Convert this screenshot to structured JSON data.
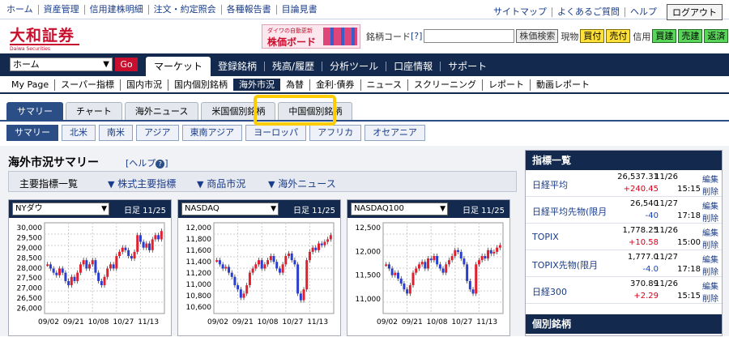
{
  "top_links": [
    "ホーム",
    "資産管理",
    "信用建株明細",
    "注文・約定照会",
    "各種報告書",
    "目論見書"
  ],
  "top_right_links": [
    "サイトマップ",
    "よくあるご質問",
    "ヘルプ"
  ],
  "logout_label": "ログアウト",
  "logo": {
    "name": "大和証券",
    "sub": "Daiwa Securities"
  },
  "banner": {
    "line1": "ダイワの自動更新",
    "line2": "株価ボード"
  },
  "code_search": {
    "label": "銘柄コード",
    "help": "[?]",
    "value": "",
    "search_btn": "株価検索",
    "genbutsu": "現物",
    "buy": "買付",
    "sell": "売付",
    "shinyo": "信用",
    "shin_buy": "買建",
    "shin_sell": "売建",
    "hensai": "返済"
  },
  "nav_select": {
    "value": "ホーム",
    "go": "Go"
  },
  "main_tabs": [
    "マーケット",
    "登録銘柄",
    "残高/履歴",
    "分析ツール",
    "口座情報",
    "サポート"
  ],
  "sub_nav": [
    "My Page",
    "スーパー指標",
    "国内市況",
    "国内個別銘柄",
    "海外市況",
    "為替",
    "金利·債券",
    "ニュース",
    "スクリーニング",
    "レポート",
    "動画レポート"
  ],
  "tabs": [
    "サマリー",
    "チャート",
    "海外ニュース",
    "米国個別銘柄",
    "中国個別銘柄"
  ],
  "regions": [
    "サマリー",
    "北米",
    "南米",
    "アジア",
    "東南アジア",
    "ヨーロッパ",
    "アフリカ",
    "オセアニア"
  ],
  "page_title": "海外市況サマリー",
  "page_help": "[ヘルプ",
  "page_help_end": "]",
  "info_bar": {
    "title": "主要指標一覧",
    "links": [
      "株式主要指標",
      "商品市況",
      "海外ニュース"
    ]
  },
  "charts": [
    {
      "name": "NYダウ",
      "period": "日足 11/25",
      "yticks": [
        "30,000",
        "29,000",
        "28,000",
        "27,000",
        "26,000"
      ],
      "yticks_half": [
        "29,500",
        "28,500",
        "27,500",
        "26,500"
      ],
      "xticks": [
        "09/02",
        "09/21",
        "10/08",
        "10/27",
        "11/13"
      ]
    },
    {
      "name": "NASDAQ",
      "period": "日足 11/25",
      "yticks": [
        "12,000",
        "11,600",
        "11,200",
        "10,800"
      ],
      "yticks_half": [
        "11,800",
        "11,400",
        "11,000",
        "10,600"
      ],
      "xticks": [
        "09/02",
        "09/21",
        "10/08",
        "10/27",
        "11/13"
      ]
    },
    {
      "name": "NASDAQ100",
      "period": "日足 11/25",
      "yticks": [
        "12,500",
        "12,000",
        "11,500",
        "11,000"
      ],
      "yticks_half": [],
      "xticks": [
        "09/02",
        "09/21",
        "10/08",
        "10/27",
        "11/13"
      ]
    }
  ],
  "side": {
    "title": "指標一覧",
    "rows": [
      {
        "name": "日経平均",
        "value": "26,537.31",
        "change": "+240.45",
        "date": "11/26",
        "time": "15:15",
        "dir": "up"
      },
      {
        "name": "日経平均先物(限月",
        "value": "26,540",
        "change": "-40",
        "date": "11/27",
        "time": "17:18",
        "dir": "dn"
      },
      {
        "name": "TOPIX",
        "value": "1,778.25",
        "change": "+10.58",
        "date": "11/26",
        "time": "15:00",
        "dir": "up"
      },
      {
        "name": "TOPIX先物(限月",
        "value": "1,777.0",
        "change": "-4.0",
        "date": "11/27",
        "time": "17:18",
        "dir": "dn"
      },
      {
        "name": "日経300",
        "value": "370.89",
        "change": "+2.29",
        "date": "11/26",
        "time": "15:15",
        "dir": "up"
      }
    ],
    "edit": "編集",
    "del": "削除",
    "section2": "個別銘柄"
  },
  "colors": {
    "navy": "#13294d",
    "red": "#d4001a",
    "blue": "#1740c0",
    "highlight": "#ffcc00"
  }
}
